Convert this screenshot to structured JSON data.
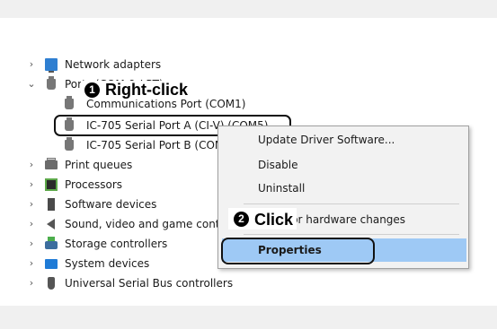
{
  "tree": {
    "items": [
      {
        "label": "Network adapters",
        "icon": "network-icon",
        "expander": "collapsed"
      },
      {
        "label": "Ports (COM & LPT)",
        "icon": "port-icon",
        "expander": "expanded"
      },
      {
        "label": "Communications Port (COM1)",
        "icon": "port-icon",
        "expander": "none"
      },
      {
        "label": "IC-705 Serial Port A (CI-V) (COM5)",
        "icon": "port-icon",
        "expander": "none"
      },
      {
        "label": "IC-705 Serial Port B (COM6)",
        "icon": "port-icon",
        "expander": "none"
      },
      {
        "label": "Print queues",
        "icon": "printer-icon",
        "expander": "collapsed"
      },
      {
        "label": "Processors",
        "icon": "processor-icon",
        "expander": "collapsed"
      },
      {
        "label": "Software devices",
        "icon": "software-icon",
        "expander": "collapsed"
      },
      {
        "label": "Sound, video and game controllers",
        "icon": "speaker-icon",
        "expander": "collapsed"
      },
      {
        "label": "Storage controllers",
        "icon": "storage-icon",
        "expander": "collapsed"
      },
      {
        "label": "System devices",
        "icon": "system-icon",
        "expander": "collapsed"
      },
      {
        "label": "Universal Serial Bus controllers",
        "icon": "usb-icon",
        "expander": "collapsed"
      }
    ]
  },
  "context_menu": {
    "update": "Update Driver Software...",
    "disable": "Disable",
    "uninstall": "Uninstall",
    "scan": "Scan for hardware changes",
    "properties": "Properties"
  },
  "callouts": {
    "step1_num": "1",
    "step1_text": "Right-click",
    "step2_num": "2",
    "step2_text": "Click"
  },
  "colors": {
    "menu_highlight": "#9ec9f5",
    "callout_border": "#111111"
  }
}
